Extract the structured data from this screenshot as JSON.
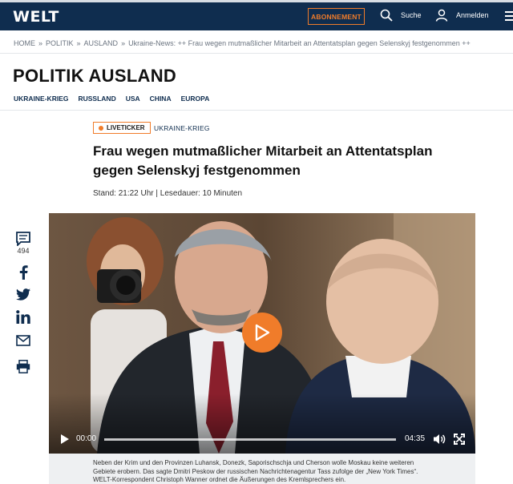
{
  "header": {
    "logo": "WELT",
    "subscribe_label": "ABONNEMENT",
    "search_label": "Suche",
    "login_label": "Anmelden"
  },
  "breadcrumb": {
    "items": [
      "HOME",
      "POLITIK",
      "AUSLAND",
      "Ukraine-News: ++ Frau wegen mutmaßlicher Mitarbeit an Attentatsplan gegen Selenskyj festgenommen ++"
    ],
    "separator": "»"
  },
  "section": {
    "title": "POLITIK AUSLAND",
    "subnav": [
      "UKRAINE-KRIEG",
      "RUSSLAND",
      "USA",
      "CHINA",
      "EUROPA"
    ]
  },
  "article": {
    "badge": "LIVETICKER",
    "topic": "UKRAINE-KRIEG",
    "headline": "Frau wegen mutmaßlicher Mitarbeit an Attentatsplan gegen Selenskyj festgenommen",
    "meta": "Stand: 21:22 Uhr | Lesedauer: 10 Minuten"
  },
  "share": {
    "comment_count": "494",
    "icons": [
      "comment-icon",
      "facebook-icon",
      "twitter-icon",
      "linkedin-icon",
      "mail-icon",
      "print-icon"
    ]
  },
  "video": {
    "current_time": "00:00",
    "duration": "04:35",
    "progress": 0
  },
  "caption": {
    "text": "Neben der Krim und den Provinzen Luhansk, Donezk, Saporischschja und Cherson wolle Moskau keine weiteren Gebiete erobern. Das sagte Dmitri Peskow der russischen Nachrichtenagentur Tass zufolge der „New York Times“. WELT-Korrespondent Christoph Wanner ordnet die Äußerungen des Kremlsprechers ein."
  },
  "colors": {
    "brand_navy": "#0f2d4f",
    "accent_orange": "#f07c2a"
  }
}
